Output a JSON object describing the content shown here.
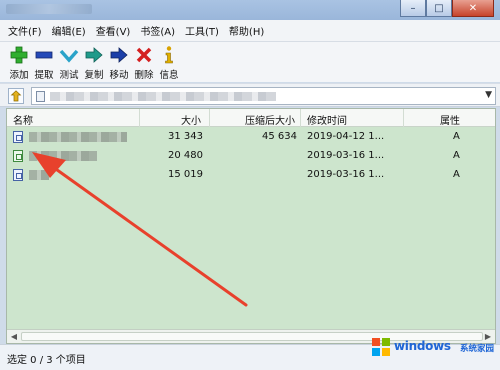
{
  "menu": {
    "items": [
      "文件(F)",
      "编辑(E)",
      "查看(V)",
      "书签(A)",
      "工具(T)",
      "帮助(H)"
    ]
  },
  "toolbar": {
    "tools": [
      {
        "label": "添加",
        "icon": "add-icon"
      },
      {
        "label": "提取",
        "icon": "extract-icon"
      },
      {
        "label": "测试",
        "icon": "test-icon"
      },
      {
        "label": "复制",
        "icon": "copy-icon"
      },
      {
        "label": "移动",
        "icon": "move-icon"
      },
      {
        "label": "删除",
        "icon": "delete-icon"
      },
      {
        "label": "信息",
        "icon": "info-icon"
      }
    ]
  },
  "columns": {
    "name": "名称",
    "size": "大小",
    "packed": "压缩后大小",
    "modified": "修改时间",
    "attr": "属性"
  },
  "files": [
    {
      "size": "31 343",
      "packed": "45 634",
      "modified": "2019-04-12 1...",
      "attr": "A",
      "icon": "file-icon"
    },
    {
      "size": "20 480",
      "packed": "",
      "modified": "2019-03-16 1...",
      "attr": "A",
      "icon": "file-icon"
    },
    {
      "size": "15 019",
      "packed": "",
      "modified": "2019-03-16 1...",
      "attr": "A",
      "icon": "file-icon"
    }
  ],
  "status": {
    "text": "选定 0 / 3 个项目"
  },
  "watermark": {
    "brand": "windows",
    "suffix": "系统家园"
  },
  "colors": {
    "list_bg": "#cde5cd",
    "annotation_arrow": "#e8412c"
  }
}
